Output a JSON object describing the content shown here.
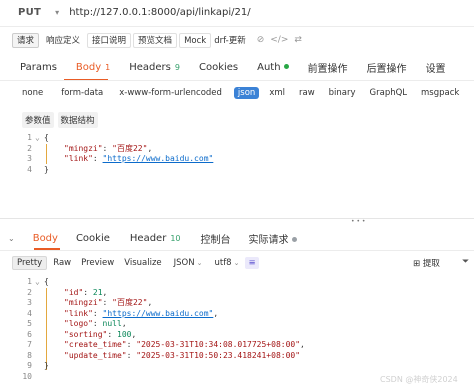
{
  "request": {
    "method": "PUT",
    "url": "http://127.0.0.1:8000/api/linkapi/21/"
  },
  "doc_tabs": [
    "请求",
    "响应定义",
    "接口说明",
    "预览文档",
    "Mock",
    "drf-更新"
  ],
  "request_tabs": [
    {
      "label": "Params",
      "count": ""
    },
    {
      "label": "Body",
      "count": "1"
    },
    {
      "label": "Headers",
      "count": "9"
    },
    {
      "label": "Cookies",
      "count": ""
    },
    {
      "label": "Auth",
      "count": ""
    },
    {
      "label": "前置操作",
      "count": ""
    },
    {
      "label": "后置操作",
      "count": ""
    },
    {
      "label": "设置",
      "count": ""
    }
  ],
  "body_types": [
    "none",
    "form-data",
    "x-www-form-urlencoded",
    "json",
    "xml",
    "raw",
    "binary",
    "GraphQL",
    "msgpack"
  ],
  "body_sub_tabs": [
    "参数值",
    "数据结构"
  ],
  "request_body": {
    "line_numbers": [
      "1",
      "2",
      "3",
      "4"
    ],
    "open": "{",
    "key1": "\"mingzi\"",
    "val1": "\"百度22\"",
    "key2": "\"link\"",
    "val2": "\"https://www.baidu.com\"",
    "close": "}"
  },
  "response_tabs": [
    {
      "label": "Body",
      "count": ""
    },
    {
      "label": "Cookie",
      "count": ""
    },
    {
      "label": "Header",
      "count": "10"
    },
    {
      "label": "控制台",
      "count": ""
    },
    {
      "label": "实际请求",
      "count": ""
    }
  ],
  "response_tools": {
    "pretty": "Pretty",
    "raw": "Raw",
    "preview": "Preview",
    "visualize": "Visualize",
    "format": "JSON",
    "encoding": "utf8",
    "extract": "提取"
  },
  "response_body": {
    "line_numbers": [
      "1",
      "2",
      "3",
      "4",
      "5",
      "6",
      "7",
      "8",
      "9",
      "10"
    ],
    "open": "{",
    "id_key": "\"id\"",
    "id_val": "21",
    "mingzi_key": "\"mingzi\"",
    "mingzi_val": "\"百度22\"",
    "link_key": "\"link\"",
    "link_val": "\"https://www.baidu.com\"",
    "logo_key": "\"logo\"",
    "logo_val": "null",
    "sorting_key": "\"sorting\"",
    "sorting_val": "100",
    "ct_key": "\"create_time\"",
    "ct_val": "\"2025-03-31T10:34:08.017725+08:00\"",
    "ut_key": "\"update_time\"",
    "ut_val": "\"2025-03-31T10:50:23.418241+08:00\"",
    "close": "}"
  },
  "watermark": "CSDN @神奇侠2024",
  "colors": {
    "accent": "#e95c26",
    "json_badge": "#3b82d6",
    "auth_dot": "#28a745",
    "count": "#35a06b"
  }
}
